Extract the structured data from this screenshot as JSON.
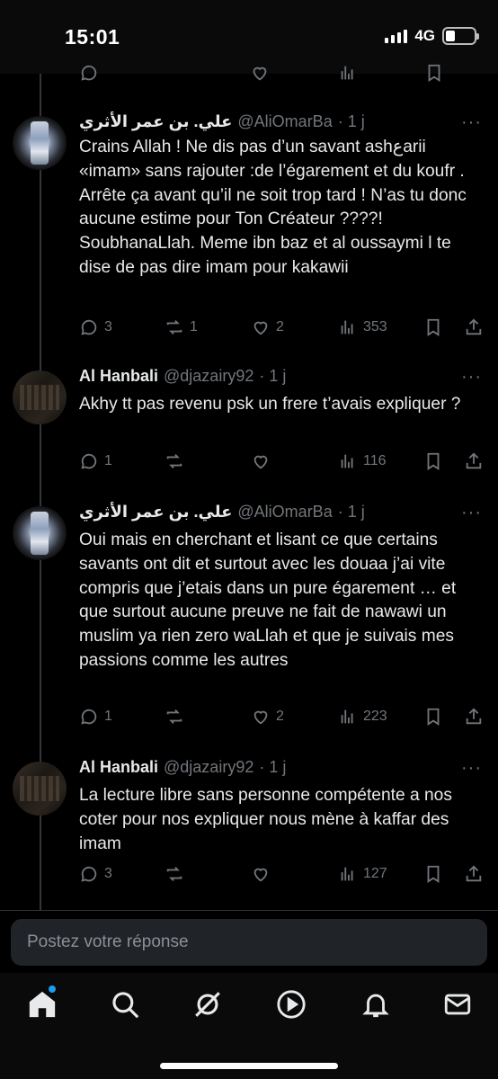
{
  "status_bar": {
    "time": "15:01",
    "network": "4G"
  },
  "tweets": [
    {
      "name": "علي. بن عمر الأثري",
      "handle": "@AliOmarBa",
      "time": "· 1 j",
      "text": "Crains Allah ! Ne dis pas d’un savant ashعarii «imam» sans rajouter :de l’égarement et du koufr . Arrête ça avant qu’il ne soit trop tard ! N’as tu donc aucune estime pour Ton Créateur ????! SoubhanaLlah. Meme ibn baz et al oussaymi l te dise de pas dire imam pour kakawii",
      "replies": "3",
      "reposts": "1",
      "likes": "2",
      "views": "353"
    },
    {
      "name": "Al Hanbali",
      "handle": "@djazairy92",
      "time": "· 1 j",
      "text": "Akhy tt pas revenu psk un frere t’avais expliquer ?",
      "replies": "1",
      "reposts": "",
      "likes": "",
      "views": "116"
    },
    {
      "name": "علي. بن عمر الأثري",
      "handle": "@AliOmarBa",
      "time": "· 1 j",
      "text": "Oui mais en cherchant et lisant ce que certains savants ont dit et surtout avec les douaa j’ai vite compris que j’etais dans un pure égarement … et que surtout aucune preuve ne fait de nawawi un muslim ya rien zero waLlah et que je suivais mes passions comme les autres",
      "replies": "1",
      "reposts": "",
      "likes": "2",
      "views": "223"
    },
    {
      "name": "Al Hanbali",
      "handle": "@djazairy92",
      "time": "· 1 j",
      "text": "La lecture libre sans personne compétente a nos coter pour nos expliquer nous mène à kaffar des imam",
      "replies": "3",
      "reposts": "",
      "likes": "",
      "views": "127"
    }
  ],
  "reply_bar": {
    "placeholder": "Postez votre réponse"
  },
  "bottom_nav": [
    "home-icon",
    "search-icon",
    "grok-icon",
    "video-icon",
    "notifications-icon",
    "messages-icon"
  ],
  "colors": {
    "accent": "#1d9bf0",
    "muted": "#71767b",
    "text": "#e7e9ea",
    "background": "#000000"
  }
}
